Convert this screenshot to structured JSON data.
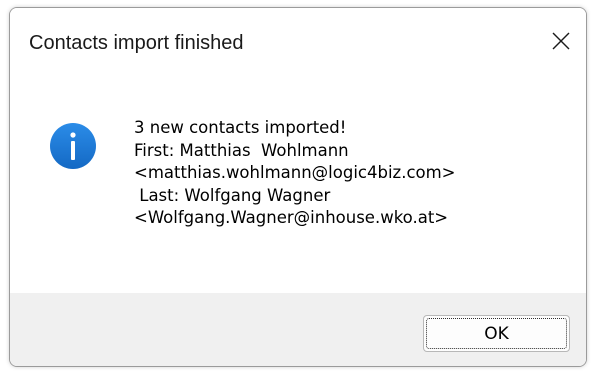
{
  "window": {
    "title": "Contacts import finished",
    "close_icon": "close-icon"
  },
  "message": {
    "icon": "info-icon",
    "lines": [
      "3 new contacts imported!",
      "First: Matthias  Wohlmann",
      "<matthias.wohlmann@logic4biz.com>",
      " Last: Wolfgang Wagner",
      "<Wolfgang.Wagner@inhouse.wko.at>"
    ]
  },
  "buttons": {
    "ok_label": "OK"
  },
  "colors": {
    "icon_blue": "#1a78d6",
    "footer_bg": "#f0f0f0"
  }
}
